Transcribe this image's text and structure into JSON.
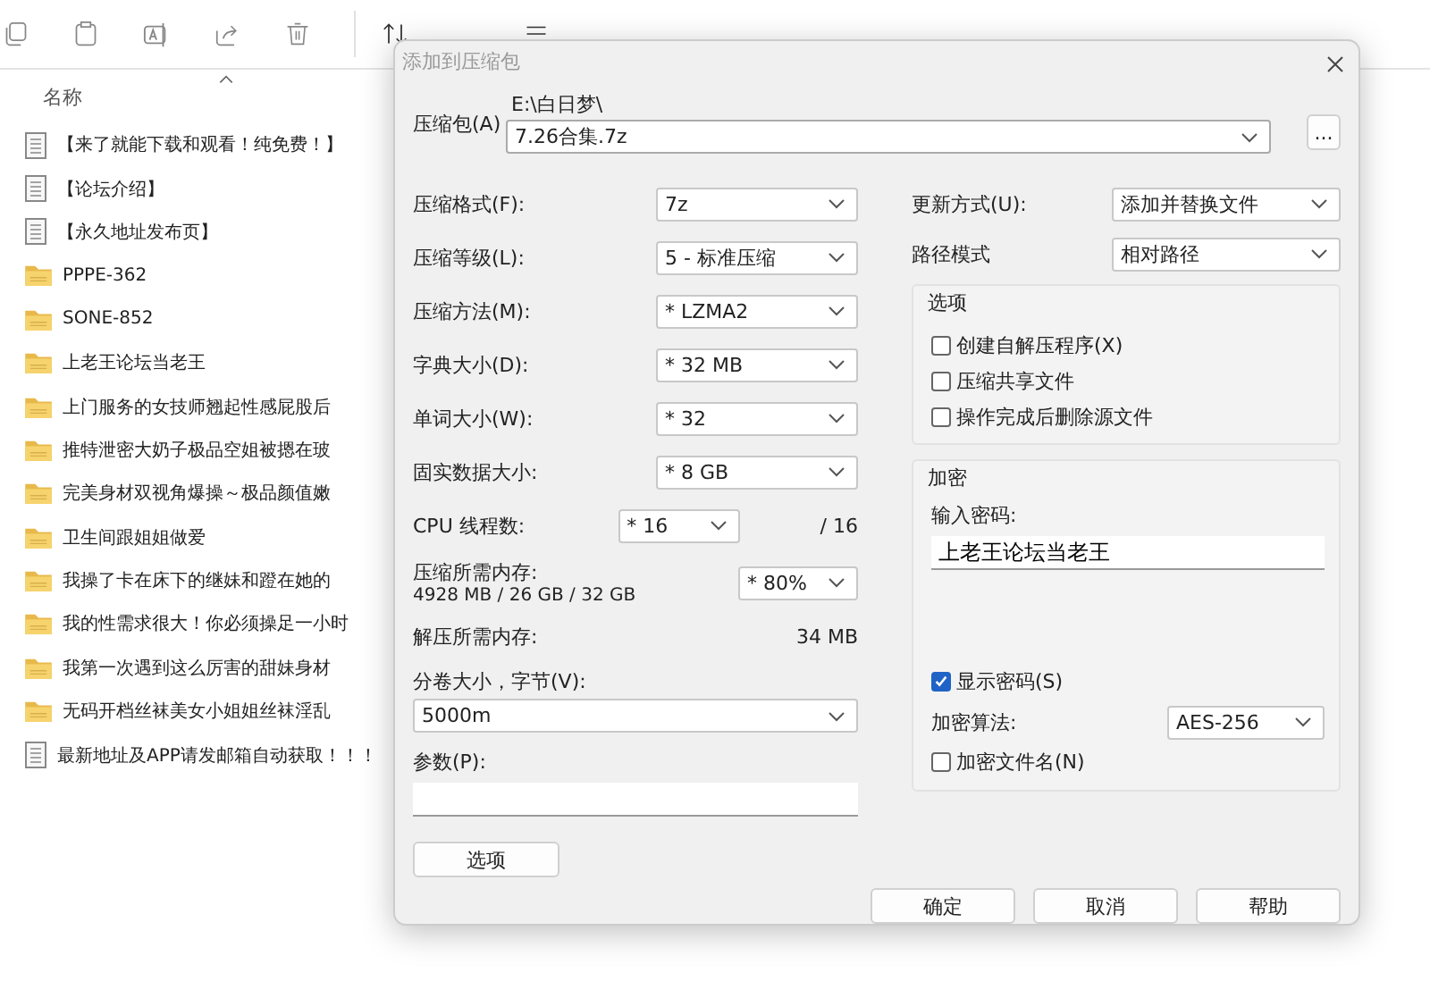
{
  "file_list": {
    "column": "名称",
    "files": [
      {
        "name": "【来了就能下载和观看！纯免费！】",
        "kind": "document"
      },
      {
        "name": "【论坛介绍】",
        "kind": "document"
      },
      {
        "name": "【永久地址发布页】",
        "kind": "document"
      },
      {
        "name": "PPPE-362",
        "kind": "folder"
      },
      {
        "name": "SONE-852",
        "kind": "folder"
      },
      {
        "name": "上老王论坛当老王",
        "kind": "folder"
      },
      {
        "name": "上门服务的女技师翘起性感屁股后",
        "kind": "folder"
      },
      {
        "name": "推特泄密大奶子极品空姐被摁在玻",
        "kind": "folder"
      },
      {
        "name": "完美身材双视角爆操～极品颜值嫩",
        "kind": "folder"
      },
      {
        "name": "卫生间跟姐姐做爱",
        "kind": "folder"
      },
      {
        "name": "我操了卡在床下的继妹和蹬在她的",
        "kind": "folder"
      },
      {
        "name": "我的性需求很大！你必须操足一小时",
        "kind": "folder"
      },
      {
        "name": "我第一次遇到这么厉害的甜妹身材",
        "kind": "folder"
      },
      {
        "name": "无码开档丝袜美女小姐姐丝袜淫乱",
        "kind": "folder"
      },
      {
        "name": "最新地址及APP请发邮箱自动获取！！！",
        "kind": "document"
      }
    ]
  },
  "dialog": {
    "title": "添加到压缩包",
    "archive": {
      "label": "压缩包(A)",
      "path": "E:\\白日梦\\",
      "value": "7.26合集.7z",
      "browse": "..."
    },
    "settings": [
      {
        "label": "压缩格式(F):",
        "value": "7z"
      },
      {
        "label": "压缩等级(L):",
        "value": "5 - 标准压缩"
      },
      {
        "label": "压缩方法(M):",
        "value": "* LZMA2"
      },
      {
        "label": "字典大小(D):",
        "value": "* 32 MB"
      },
      {
        "label": "单词大小(W):",
        "value": "* 32"
      },
      {
        "label": "固实数据大小:",
        "value": "* 8 GB"
      }
    ],
    "threads": {
      "label": "CPU 线程数:",
      "value": "* 16",
      "max": "/ 16"
    },
    "memory": {
      "label": "压缩所需内存:",
      "detail": "4928 MB / 26 GB / 32 GB",
      "value": "* 80%"
    },
    "decompress_memory": {
      "label": "解压所需内存:",
      "value": "34 MB"
    },
    "volume": {
      "label": "分卷大小，字节(V):",
      "value": "5000m"
    },
    "parameters": {
      "label": "参数(P):"
    },
    "options_button": "选项",
    "update_mode": {
      "label": "更新方式(U):",
      "value": "添加并替换文件"
    },
    "path_mode": {
      "label": "路径模式",
      "value": "相对路径"
    },
    "options": {
      "title": "选项",
      "checkboxes": [
        {
          "label": "创建自解压程序(X)",
          "checked": false
        },
        {
          "label": "压缩共享文件",
          "checked": false
        },
        {
          "label": "操作完成后删除源文件",
          "checked": false
        }
      ]
    },
    "encryption": {
      "title": "加密",
      "password_label": "输入密码:",
      "password": "上老王论坛当老王",
      "show_password": {
        "label": "显示密码(S)",
        "checked": true
      },
      "method": {
        "label": "加密算法:",
        "value": "AES-256"
      },
      "encrypt_names": {
        "label": "加密文件名(N)",
        "checked": false
      }
    },
    "buttons": [
      "确定",
      "取消",
      "帮助"
    ]
  }
}
